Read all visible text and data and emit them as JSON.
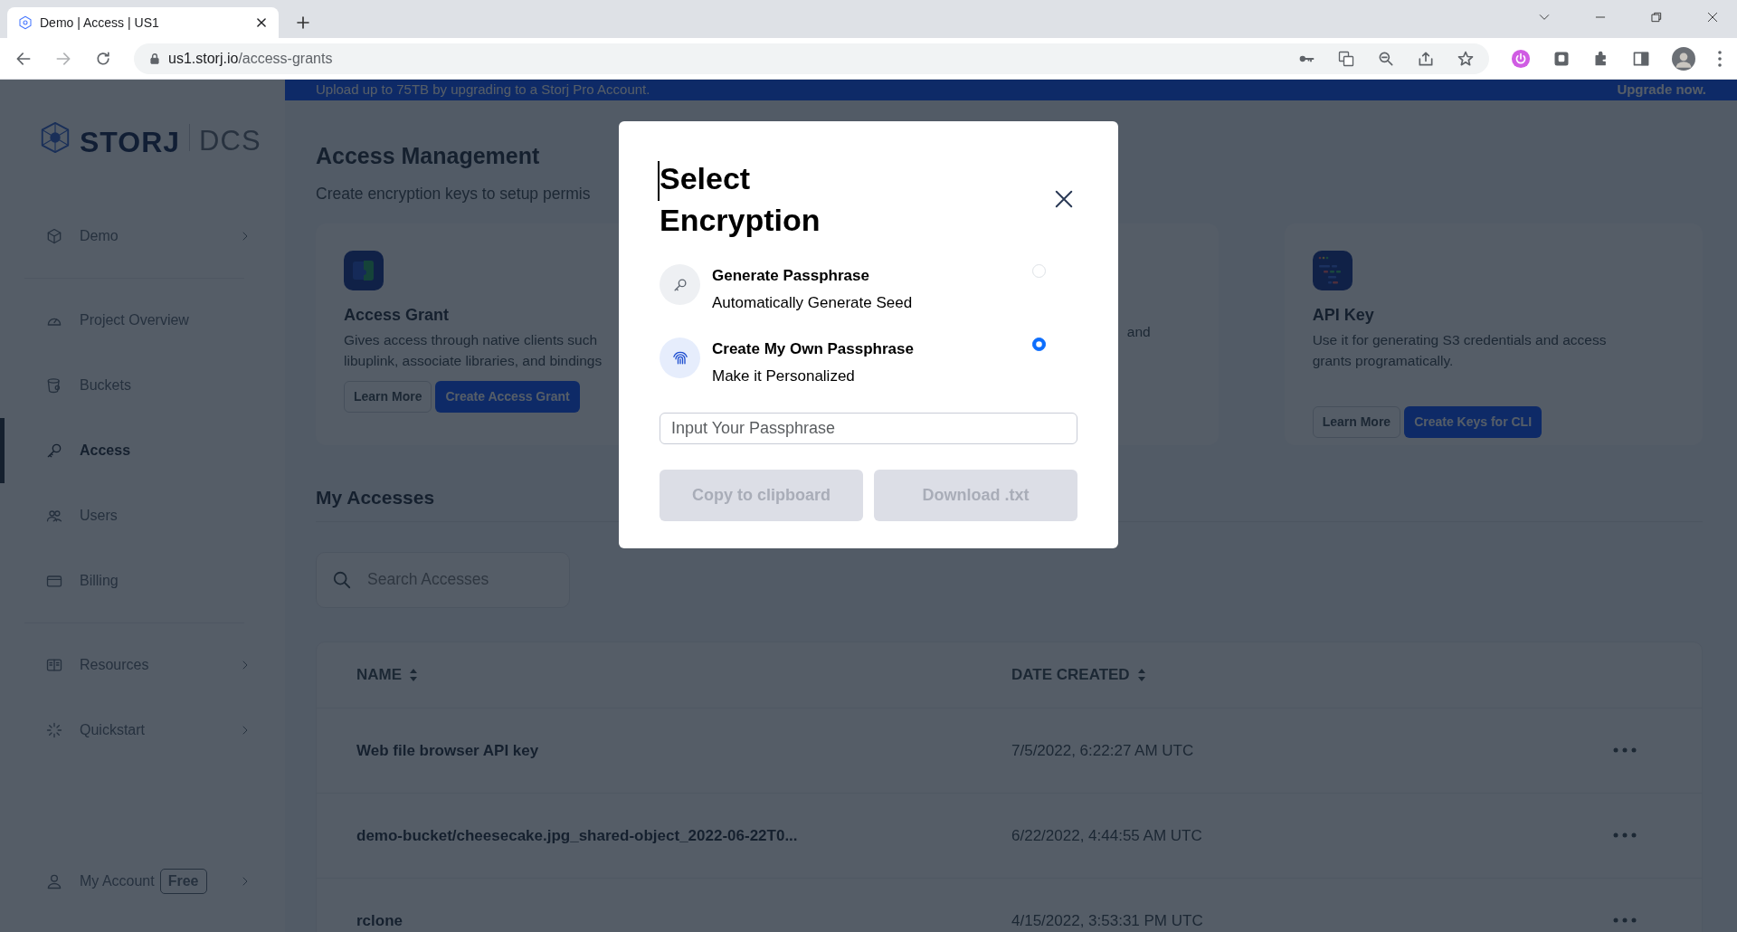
{
  "browser": {
    "tab": {
      "title": "Demo | Access | US1"
    },
    "url": {
      "host": "us1.storj.io",
      "path": "/access-grants"
    }
  },
  "banner": {
    "message": "Upload up to 75TB by upgrading to a Storj Pro Account.",
    "link": "Upgrade now."
  },
  "sidebar": {
    "logo": {
      "brand": "STORJ",
      "product": "DCS"
    },
    "groups": [
      [
        {
          "label": "Demo",
          "selected": false,
          "expandable": true
        }
      ],
      [
        {
          "label": "Project Overview",
          "selected": false,
          "expandable": false
        },
        {
          "label": "Buckets",
          "selected": false,
          "expandable": false
        },
        {
          "label": "Access",
          "selected": true,
          "expandable": false
        },
        {
          "label": "Users",
          "selected": false,
          "expandable": false
        },
        {
          "label": "Billing",
          "selected": false,
          "expandable": false
        }
      ],
      [
        {
          "label": "Resources",
          "selected": false,
          "expandable": true
        },
        {
          "label": "Quickstart",
          "selected": false,
          "expandable": true
        }
      ]
    ],
    "account": {
      "label": "My Account",
      "badge": "Free",
      "expandable": true
    }
  },
  "page": {
    "title": "Access Management",
    "subtitle": "Create encryption keys to setup permis",
    "cards": [
      {
        "title": "Access Grant",
        "description_lines": [
          "Gives access through native clients such",
          "libuplink, associate libraries, and bindings"
        ],
        "buttons": [
          "Learn More",
          "Create Access Grant"
        ]
      },
      {
        "description_lines": [
          "and"
        ]
      },
      {
        "title": "API Key",
        "description_lines": [
          "Use it for generating S3 credentials and access",
          "grants programatically."
        ],
        "buttons": [
          "Learn More",
          "Create Keys for CLI"
        ]
      }
    ]
  },
  "accesses": {
    "title": "My Accesses",
    "search": {
      "placeholder": "Search Accesses"
    },
    "columns": [
      {
        "label": "NAME"
      },
      {
        "label": "DATE CREATED"
      }
    ],
    "rows": [
      {
        "name": "Web file browser API key",
        "date": "7/5/2022, 6:22:27 AM UTC"
      },
      {
        "name": "demo-bucket/cheesecake.jpg_shared-object_2022-06-22T0...",
        "date": "6/22/2022, 4:44:55 AM UTC"
      },
      {
        "name": "rclone",
        "date": "4/15/2022, 3:53:31 PM UTC"
      }
    ]
  },
  "modal": {
    "title": "Select Encryption",
    "options": [
      {
        "title": "Generate Passphrase",
        "subtitle": "Automatically Generate Seed",
        "selected": false
      },
      {
        "title": "Create My Own Passphrase",
        "subtitle": "Make it Personalized",
        "selected": true
      }
    ],
    "passphrase": {
      "placeholder": "Input Your Passphrase"
    },
    "buttons": [
      {
        "label": "Copy to clipboard",
        "disabled": true
      },
      {
        "label": "Download .txt",
        "disabled": true
      }
    ]
  }
}
